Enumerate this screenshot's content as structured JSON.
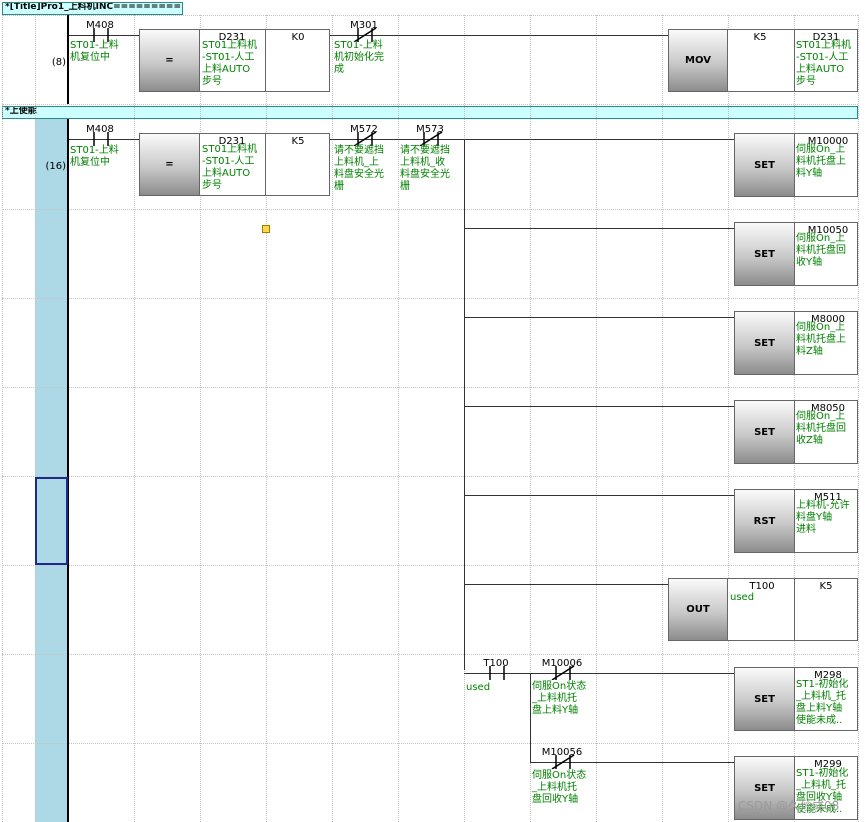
{
  "title_bar": "*[Title]Pro1_上料机INC==========",
  "section_bar": "*上使能",
  "step_numbers": [
    "(8)",
    "(16)"
  ],
  "rung8": {
    "contact_m408": {
      "device": "M408",
      "comment": "ST01-上料\n机复位中"
    },
    "compare": {
      "op": "=",
      "src1": "D231",
      "src1_comment": "ST01上料机\n-ST01-人工\n上料AUTO\n步号",
      "src2": "K0"
    },
    "contact_m301": {
      "device": "M301",
      "comment": "ST01-上料\n机初始化完\n成"
    },
    "mov": {
      "op": "MOV",
      "src": "K5",
      "dst": "D231",
      "dst_comment": "ST01上料机\n-ST01-人工\n上料AUTO\n步号"
    }
  },
  "rung16": {
    "contact_m408": {
      "device": "M408",
      "comment": "ST01-上料\n机复位中"
    },
    "compare": {
      "op": "=",
      "src1": "D231",
      "src1_comment": "ST01上料机\n-ST01-人工\n上料AUTO\n步号",
      "src2": "K5"
    },
    "contact_m572": {
      "device": "M572",
      "comment": "请不要遮挡\n上料机_上\n料盘安全光\n栅"
    },
    "contact_m573": {
      "device": "M573",
      "comment": "请不要遮挡\n上料机_收\n料盘安全光\n栅"
    },
    "outputs": [
      {
        "op": "SET",
        "device": "M10000",
        "comment": "伺服On_上\n料机托盘上\n料Y轴"
      },
      {
        "op": "SET",
        "device": "M10050",
        "comment": "伺服On_上\n料机托盘回\n收Y轴"
      },
      {
        "op": "SET",
        "device": "M8000",
        "comment": "伺服On_上\n料机托盘上\n料Z轴"
      },
      {
        "op": "SET",
        "device": "M8050",
        "comment": "伺服On_上\n料机托盘回\n收Z轴"
      },
      {
        "op": "RST",
        "device": "M511",
        "comment": "上料机-允许\n料盘Y轴\n进料"
      }
    ],
    "timer": {
      "op": "OUT",
      "device": "T100",
      "device_note": "used",
      "preset": "K5"
    },
    "timer_contact": {
      "device": "T100",
      "note": "used"
    },
    "branch_a": {
      "device": "M10006",
      "comment": "伺服On状态\n_上料机托\n盘上料Y轴",
      "op": "SET",
      "out_device": "M298",
      "out_comment": "ST1-初始化\n_上料机_托\n盘上料Y轴\n使能未成.."
    },
    "branch_b": {
      "device": "M10056",
      "comment": "伺服On状态\n_上料机托\n盘回收Y轴",
      "op": "SET",
      "out_device": "M299",
      "out_comment": "ST1-初始化\n_上料机_托\n盘回收Y轴\n使能未成.."
    }
  },
  "watermark": "CSDN @久炒成08"
}
